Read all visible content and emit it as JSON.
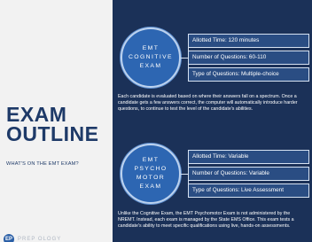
{
  "heading": {
    "line1": "EXAM",
    "line2": "OUTLINE"
  },
  "subheading": "WHAT'S ON THE EMT EXAM?",
  "logo": {
    "mark": "EP",
    "text": "PREP OLOGY"
  },
  "cognitive": {
    "label": "EMT\nCOGNITIVE\nEXAM",
    "time": "Allotted Time: 120 minutes",
    "questions": "Number of Questions: 60-110",
    "type": "Type of Questions: Multiple-choice",
    "description": "Each candidate is evaluated based on where their answers fall on a spectrum. Once a candidate gets a few answers correct, the computer will automatically introduce harder questions, to continue to test the level of the candidate's abilities."
  },
  "psychomotor": {
    "label": "EMT\nPSYCHO\nMOTOR\nEXAM",
    "time": "Allotted Time: Variable",
    "questions": "Number of Questions: Variable",
    "type": "Type of Questions: Live Assessment",
    "description": "Unlike the Cognitive Exam, the EMT Psychomotor Exam is not administered by the NREMT. Instead, each exam is managed by the State EMS Office. This exam tests a candidate's ability to meet specific qualifications using live, hands-on assessments."
  },
  "colors": {
    "navy": "#1b3158",
    "circle_blue": "#2d66b2",
    "title_blue": "#1e3a68"
  }
}
